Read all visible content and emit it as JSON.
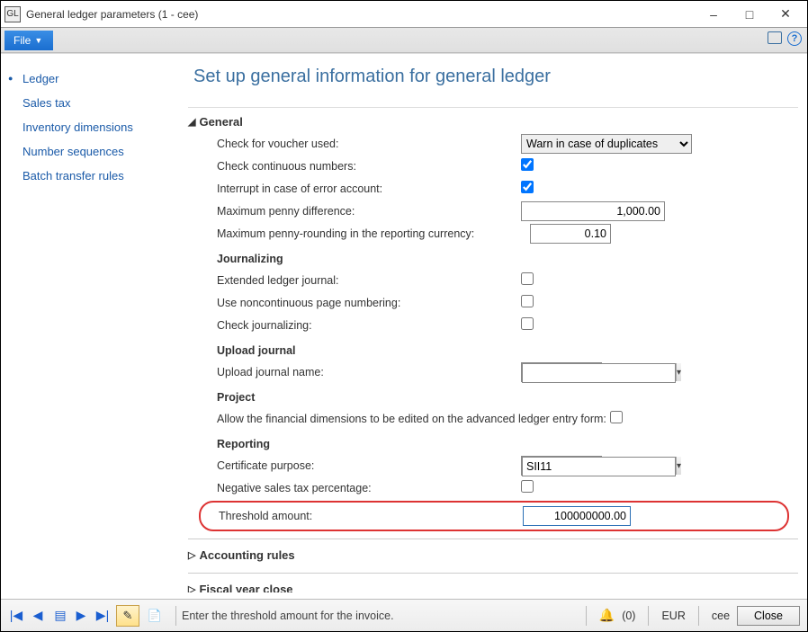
{
  "window": {
    "title": "General ledger parameters (1 - cee)",
    "app_icon_label": "GL"
  },
  "menu": {
    "file_label": "File"
  },
  "sidebar": {
    "items": [
      {
        "label": "Ledger",
        "active": true
      },
      {
        "label": "Sales tax"
      },
      {
        "label": "Inventory dimensions"
      },
      {
        "label": "Number sequences"
      },
      {
        "label": "Batch transfer rules"
      }
    ]
  },
  "page": {
    "title": "Set up general information for general ledger",
    "sections": {
      "general": {
        "heading": "General",
        "rows": {
          "check_voucher": {
            "label": "Check for voucher used:",
            "value": "Warn in case of duplicates"
          },
          "check_continuous": {
            "label": "Check continuous numbers:",
            "checked": true
          },
          "interrupt_error": {
            "label": "Interrupt in case of error account:",
            "checked": true
          },
          "max_penny_diff": {
            "label": "Maximum penny difference:",
            "value": "1,000.00"
          },
          "max_penny_round": {
            "label": "Maximum penny-rounding in the reporting currency:",
            "value": "0.10"
          }
        },
        "subsections": {
          "journalizing": {
            "heading": "Journalizing",
            "rows": {
              "ext_ledger": {
                "label": "Extended ledger journal:",
                "checked": false
              },
              "noncont_page": {
                "label": "Use noncontinuous page numbering:",
                "checked": false
              },
              "check_journal": {
                "label": "Check journalizing:",
                "checked": false
              }
            }
          },
          "upload": {
            "heading": "Upload journal",
            "rows": {
              "upload_name": {
                "label": "Upload journal name:",
                "value": ""
              }
            }
          },
          "project": {
            "heading": "Project",
            "rows": {
              "allow_fin_dim": {
                "label": "Allow the financial dimensions to be edited on the advanced ledger entry form:",
                "checked": false
              }
            }
          },
          "reporting": {
            "heading": "Reporting",
            "rows": {
              "cert_purpose": {
                "label": "Certificate purpose:",
                "value": "SII11"
              },
              "neg_sales_tax": {
                "label": "Negative sales tax percentage:",
                "checked": false
              },
              "threshold": {
                "label": "Threshold amount:",
                "value": "100000000.00"
              }
            }
          }
        }
      },
      "accounting_rules": {
        "heading": "Accounting rules"
      },
      "fiscal_year_close": {
        "heading": "Fiscal year close"
      }
    }
  },
  "footer": {
    "hint": "Enter the threshold amount for the invoice.",
    "notifications": "(0)",
    "currency": "EUR",
    "company": "cee",
    "close": "Close"
  }
}
